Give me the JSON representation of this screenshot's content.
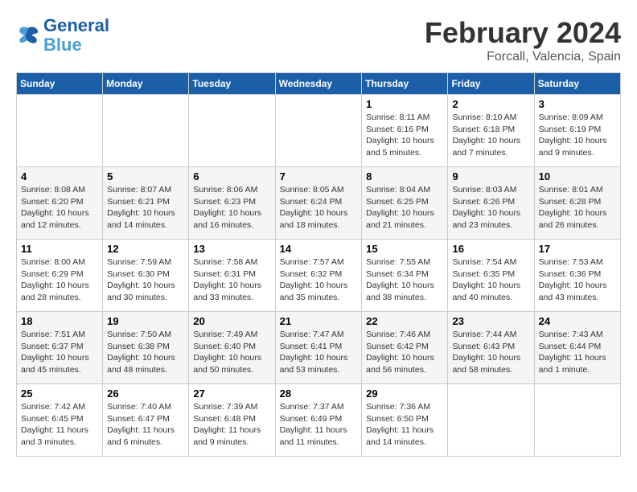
{
  "header": {
    "logo_general": "General",
    "logo_blue": "Blue",
    "title": "February 2024",
    "subtitle": "Forcall, Valencia, Spain"
  },
  "columns": [
    "Sunday",
    "Monday",
    "Tuesday",
    "Wednesday",
    "Thursday",
    "Friday",
    "Saturday"
  ],
  "weeks": [
    [
      {
        "day": "",
        "info": ""
      },
      {
        "day": "",
        "info": ""
      },
      {
        "day": "",
        "info": ""
      },
      {
        "day": "",
        "info": ""
      },
      {
        "day": "1",
        "info": "Sunrise: 8:11 AM\nSunset: 6:16 PM\nDaylight: 10 hours\nand 5 minutes."
      },
      {
        "day": "2",
        "info": "Sunrise: 8:10 AM\nSunset: 6:18 PM\nDaylight: 10 hours\nand 7 minutes."
      },
      {
        "day": "3",
        "info": "Sunrise: 8:09 AM\nSunset: 6:19 PM\nDaylight: 10 hours\nand 9 minutes."
      }
    ],
    [
      {
        "day": "4",
        "info": "Sunrise: 8:08 AM\nSunset: 6:20 PM\nDaylight: 10 hours\nand 12 minutes."
      },
      {
        "day": "5",
        "info": "Sunrise: 8:07 AM\nSunset: 6:21 PM\nDaylight: 10 hours\nand 14 minutes."
      },
      {
        "day": "6",
        "info": "Sunrise: 8:06 AM\nSunset: 6:23 PM\nDaylight: 10 hours\nand 16 minutes."
      },
      {
        "day": "7",
        "info": "Sunrise: 8:05 AM\nSunset: 6:24 PM\nDaylight: 10 hours\nand 18 minutes."
      },
      {
        "day": "8",
        "info": "Sunrise: 8:04 AM\nSunset: 6:25 PM\nDaylight: 10 hours\nand 21 minutes."
      },
      {
        "day": "9",
        "info": "Sunrise: 8:03 AM\nSunset: 6:26 PM\nDaylight: 10 hours\nand 23 minutes."
      },
      {
        "day": "10",
        "info": "Sunrise: 8:01 AM\nSunset: 6:28 PM\nDaylight: 10 hours\nand 26 minutes."
      }
    ],
    [
      {
        "day": "11",
        "info": "Sunrise: 8:00 AM\nSunset: 6:29 PM\nDaylight: 10 hours\nand 28 minutes."
      },
      {
        "day": "12",
        "info": "Sunrise: 7:59 AM\nSunset: 6:30 PM\nDaylight: 10 hours\nand 30 minutes."
      },
      {
        "day": "13",
        "info": "Sunrise: 7:58 AM\nSunset: 6:31 PM\nDaylight: 10 hours\nand 33 minutes."
      },
      {
        "day": "14",
        "info": "Sunrise: 7:57 AM\nSunset: 6:32 PM\nDaylight: 10 hours\nand 35 minutes."
      },
      {
        "day": "15",
        "info": "Sunrise: 7:55 AM\nSunset: 6:34 PM\nDaylight: 10 hours\nand 38 minutes."
      },
      {
        "day": "16",
        "info": "Sunrise: 7:54 AM\nSunset: 6:35 PM\nDaylight: 10 hours\nand 40 minutes."
      },
      {
        "day": "17",
        "info": "Sunrise: 7:53 AM\nSunset: 6:36 PM\nDaylight: 10 hours\nand 43 minutes."
      }
    ],
    [
      {
        "day": "18",
        "info": "Sunrise: 7:51 AM\nSunset: 6:37 PM\nDaylight: 10 hours\nand 45 minutes."
      },
      {
        "day": "19",
        "info": "Sunrise: 7:50 AM\nSunset: 6:38 PM\nDaylight: 10 hours\nand 48 minutes."
      },
      {
        "day": "20",
        "info": "Sunrise: 7:49 AM\nSunset: 6:40 PM\nDaylight: 10 hours\nand 50 minutes."
      },
      {
        "day": "21",
        "info": "Sunrise: 7:47 AM\nSunset: 6:41 PM\nDaylight: 10 hours\nand 53 minutes."
      },
      {
        "day": "22",
        "info": "Sunrise: 7:46 AM\nSunset: 6:42 PM\nDaylight: 10 hours\nand 56 minutes."
      },
      {
        "day": "23",
        "info": "Sunrise: 7:44 AM\nSunset: 6:43 PM\nDaylight: 10 hours\nand 58 minutes."
      },
      {
        "day": "24",
        "info": "Sunrise: 7:43 AM\nSunset: 6:44 PM\nDaylight: 11 hours\nand 1 minute."
      }
    ],
    [
      {
        "day": "25",
        "info": "Sunrise: 7:42 AM\nSunset: 6:45 PM\nDaylight: 11 hours\nand 3 minutes."
      },
      {
        "day": "26",
        "info": "Sunrise: 7:40 AM\nSunset: 6:47 PM\nDaylight: 11 hours\nand 6 minutes."
      },
      {
        "day": "27",
        "info": "Sunrise: 7:39 AM\nSunset: 6:48 PM\nDaylight: 11 hours\nand 9 minutes."
      },
      {
        "day": "28",
        "info": "Sunrise: 7:37 AM\nSunset: 6:49 PM\nDaylight: 11 hours\nand 11 minutes."
      },
      {
        "day": "29",
        "info": "Sunrise: 7:36 AM\nSunset: 6:50 PM\nDaylight: 11 hours\nand 14 minutes."
      },
      {
        "day": "",
        "info": ""
      },
      {
        "day": "",
        "info": ""
      }
    ]
  ]
}
